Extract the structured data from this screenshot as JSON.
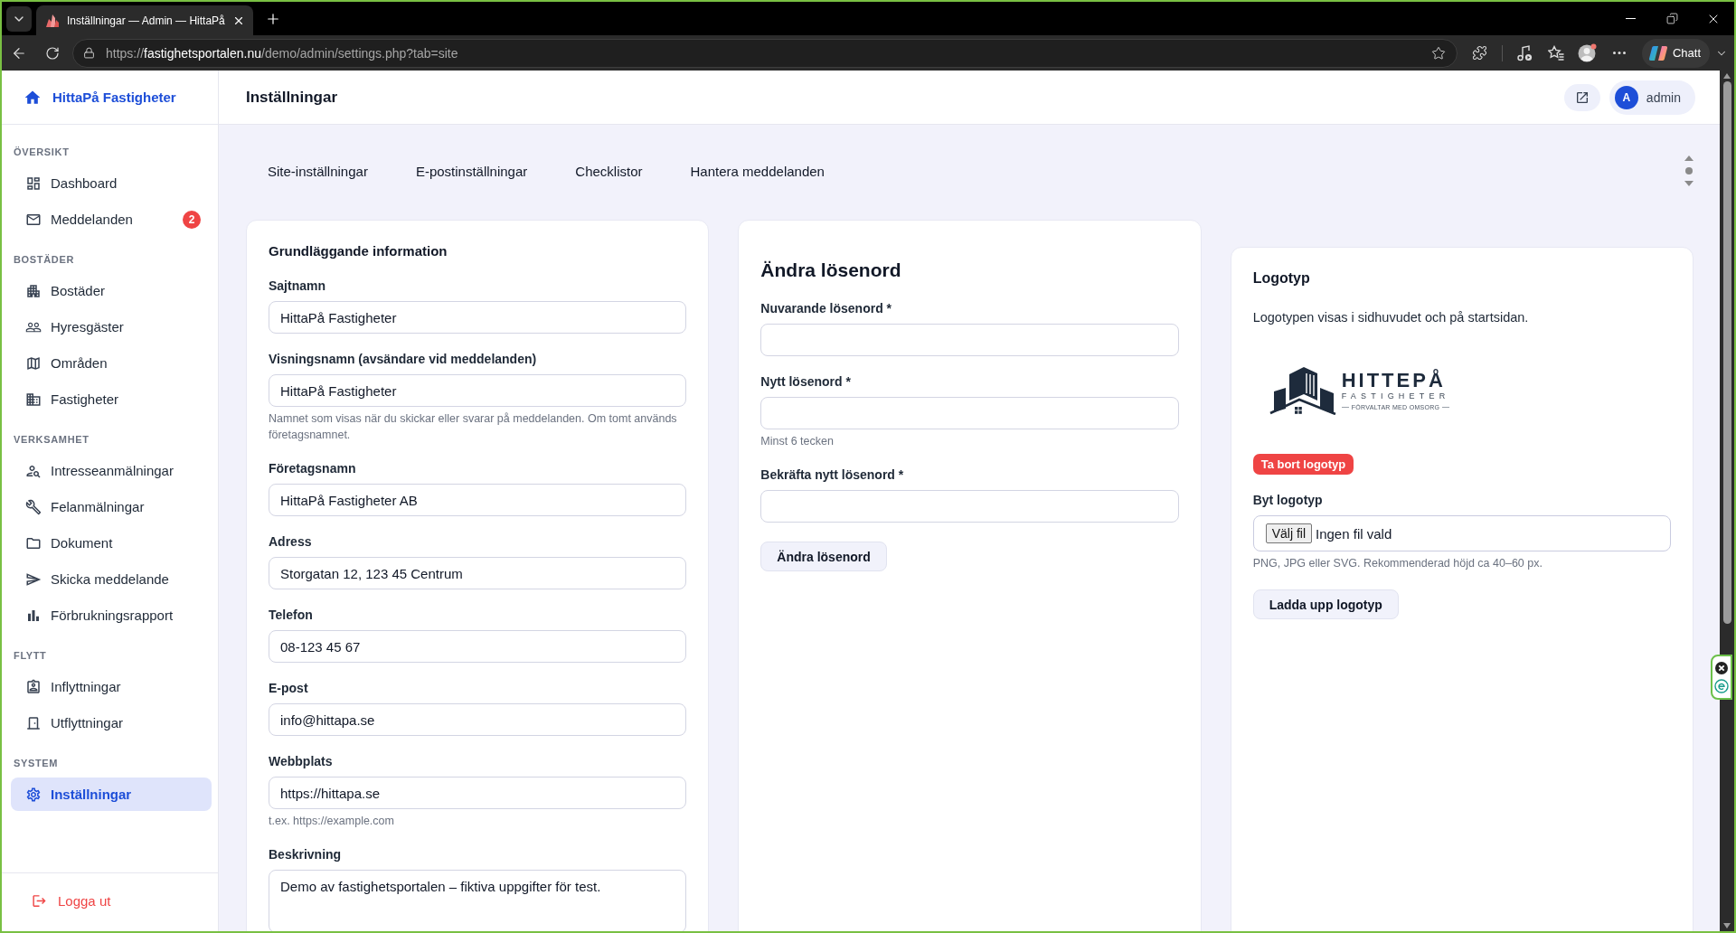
{
  "browser": {
    "tab_title": "Inställningar — Admin — HittaPå",
    "url": {
      "scheme": "https://",
      "host": "fastighetsportalen.nu",
      "path": "/demo/admin/settings.php?tab=site"
    },
    "chat_button": "Chatt"
  },
  "sidebar": {
    "brand": "HittaPå Fastigheter",
    "sections": [
      {
        "title": "ÖVERSIKT",
        "items": [
          {
            "label": "Dashboard",
            "selected": false
          },
          {
            "label": "Meddelanden",
            "selected": false,
            "badge": "2"
          }
        ]
      },
      {
        "title": "BOSTÄDER",
        "items": [
          {
            "label": "Bostäder",
            "selected": false
          },
          {
            "label": "Hyresgäster",
            "selected": false
          },
          {
            "label": "Områden",
            "selected": false
          },
          {
            "label": "Fastigheter",
            "selected": false
          }
        ]
      },
      {
        "title": "VERKSAMHET",
        "items": [
          {
            "label": "Intresseanmälningar",
            "selected": false
          },
          {
            "label": "Felanmälningar",
            "selected": false
          },
          {
            "label": "Dokument",
            "selected": false
          },
          {
            "label": "Skicka meddelande",
            "selected": false
          },
          {
            "label": "Förbrukningsrapport",
            "selected": false
          }
        ]
      },
      {
        "title": "FLYTT",
        "items": [
          {
            "label": "Inflyttningar",
            "selected": false
          },
          {
            "label": "Utflyttningar",
            "selected": false
          }
        ]
      },
      {
        "title": "SYSTEM",
        "items": [
          {
            "label": "Inställningar",
            "selected": true
          }
        ]
      }
    ],
    "logout": "Logga ut"
  },
  "header": {
    "title": "Inställningar",
    "user": {
      "initial": "A",
      "name": "admin"
    }
  },
  "tabs": [
    {
      "label": "Site-inställningar"
    },
    {
      "label": "E-postinställningar"
    },
    {
      "label": "Checklistor"
    },
    {
      "label": "Hantera meddelanden"
    }
  ],
  "basic_info": {
    "title": "Grundläggande information",
    "fields": [
      {
        "kind": "text",
        "label": "Sajtnamn",
        "value": "HittaPå Fastigheter"
      },
      {
        "kind": "text",
        "label": "Visningsnamn (avsändare vid meddelanden)",
        "value": "HittaPå Fastigheter",
        "hint": "Namnet som visas när du skickar eller svarar på meddelanden. Om tomt används företagsnamnet."
      },
      {
        "kind": "text",
        "label": "Företagsnamn",
        "value": "HittaPå Fastigheter AB"
      },
      {
        "kind": "text",
        "label": "Adress",
        "value": "Storgatan 12, 123 45 Centrum"
      },
      {
        "kind": "text",
        "label": "Telefon",
        "value": "08-123 45 67"
      },
      {
        "kind": "text",
        "label": "E-post",
        "value": "info@hittapa.se"
      },
      {
        "kind": "text",
        "label": "Webbplats",
        "value": "https://hittapa.se",
        "hint": "t.ex. https://example.com"
      },
      {
        "kind": "textarea",
        "label": "Beskrivning",
        "value": "Demo av fastighetsportalen – fiktiva uppgifter för test."
      }
    ]
  },
  "password": {
    "title": "Ändra lösenord",
    "fields": [
      {
        "kind": "password",
        "label": "Nuvarande lösenord *"
      },
      {
        "kind": "password",
        "label": "Nytt lösenord *",
        "hint": "Minst 6 tecken"
      },
      {
        "kind": "password",
        "label": "Bekräfta nytt lösenord *"
      }
    ],
    "submit": "Ändra lösenord"
  },
  "logo": {
    "title": "Logotyp",
    "description": "Logotypen visas i sidhuvudet och på startsidan.",
    "image": {
      "name": "HITTEPÅ",
      "subtitle": "FASTIGHETER",
      "tagline": "FÖRVALTAR MED OMSORG"
    },
    "remove_button": "Ta bort logotyp",
    "upload": {
      "label": "Byt logotyp",
      "choose_button": "Välj fil",
      "status": "Ingen fil vald",
      "hint": "PNG, JPG eller SVG. Rekommenderad höjd ca 40–60 px."
    },
    "submit": "Ladda upp logotyp"
  }
}
